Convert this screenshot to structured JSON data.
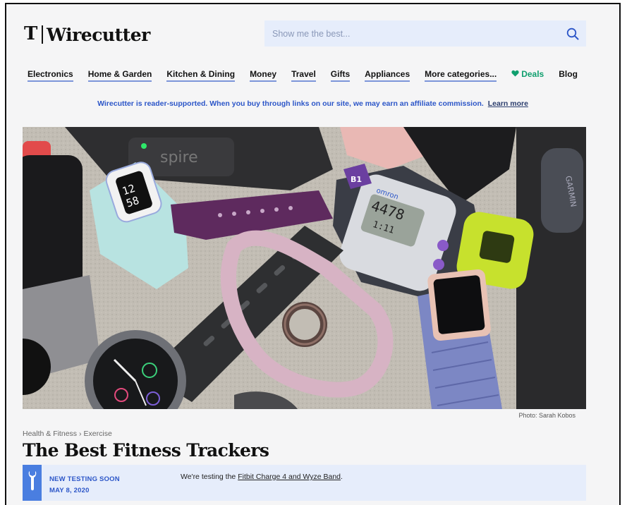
{
  "brand": {
    "mark": "𝕿",
    "name": "Wirecutter"
  },
  "search": {
    "placeholder": "Show me the best...",
    "icon": "search-icon"
  },
  "nav": {
    "items": [
      {
        "label": "Electronics"
      },
      {
        "label": "Home & Garden"
      },
      {
        "label": "Kitchen & Dining"
      },
      {
        "label": "Money"
      },
      {
        "label": "Travel"
      },
      {
        "label": "Gifts"
      },
      {
        "label": "Appliances"
      },
      {
        "label": "More categories..."
      }
    ],
    "deals_label": "Deals",
    "blog_label": "Blog",
    "deals_color": "#0f9f6e"
  },
  "affiliate": {
    "text": "Wirecutter is reader-supported. When you buy through links on our site, we may earn an affiliate commission.",
    "link": "Learn more"
  },
  "hero": {
    "credit": "Photo: Sarah Kobos",
    "watch_time": [
      "12",
      "58"
    ],
    "spire_label": "spire",
    "garmin_label": "GARMIN",
    "omron_display": [
      "4478",
      "1:11"
    ],
    "omron_brand": "omron",
    "omron_badge": "B1"
  },
  "breadcrumb": {
    "category": "Health & Fitness",
    "separator": "›",
    "subcategory": "Exercise"
  },
  "article": {
    "title": "The Best Fitness Trackers"
  },
  "notice": {
    "status": "NEW TESTING SOON",
    "date": "MAY 8, 2020",
    "text_prefix": "We're testing the",
    "link": "Fitbit Charge 4 and Wyze Band",
    "text_suffix": ".",
    "accent": "#4a7ee0"
  },
  "colors": {
    "accent_blue": "#2c56c8",
    "nav_underline": "#7c95d9",
    "search_bg": "#e6edfb"
  }
}
